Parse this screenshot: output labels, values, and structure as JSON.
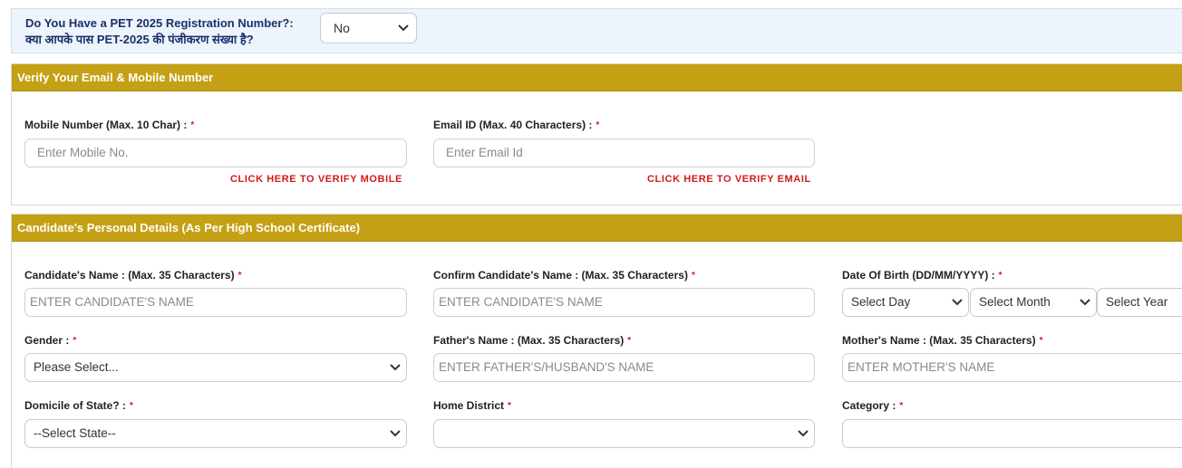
{
  "pet_question": {
    "label_en": "Do You Have a PET 2025 Registration Number?:",
    "label_hi": "क्या आपके पास PET-2025 की पंजीकरण संख्या है?",
    "selected": "No"
  },
  "verify_section": {
    "title": "Verify Your Email & Mobile Number",
    "mobile_label": "Mobile Number (Max. 10 Char) :",
    "mobile_placeholder": "Enter Mobile No.",
    "mobile_verify": "CLICK HERE TO VERIFY MOBILE",
    "email_label": "Email ID (Max. 40 Characters) :",
    "email_placeholder": "Enter Email Id",
    "email_verify": "CLICK HERE TO VERIFY EMAIL",
    "required_mark": "*"
  },
  "personal_section": {
    "title": "Candidate's Personal Details (As Per High School Certificate)",
    "name_label": "Candidate's Name : (Max. 35 Characters)",
    "name_placeholder": "ENTER CANDIDATE'S NAME",
    "confirm_name_label": "Confirm Candidate's Name : (Max. 35 Characters)",
    "confirm_name_placeholder": "ENTER CANDIDATE'S NAME",
    "dob_label": "Date Of Birth (DD/MM/YYYY) :",
    "dob_day": "Select Day",
    "dob_month": "Select Month",
    "dob_year": "Select Year",
    "gender_label": "Gender :",
    "gender_selected": "Please Select...",
    "father_label": "Father's Name : (Max. 35 Characters)",
    "father_placeholder": "ENTER FATHER'S/HUSBAND'S NAME",
    "mother_label": "Mother's Name : (Max. 35 Characters)",
    "mother_placeholder": "ENTER MOTHER'S NAME",
    "domicile_label": "Domicile of State? :",
    "domicile_selected": "--Select State--",
    "district_label": "Home District",
    "district_selected": "",
    "category_label": "Category :",
    "category_selected": "",
    "required_mark": "*"
  }
}
